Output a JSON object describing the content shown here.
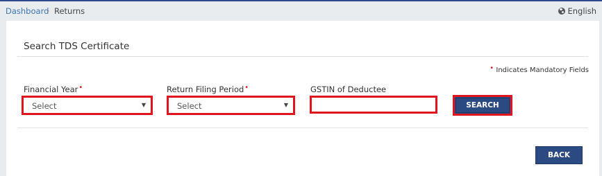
{
  "breadcrumb": {
    "dashboard": "Dashboard",
    "separator": "›",
    "current": "Returns"
  },
  "language": {
    "label": "English",
    "icon": "globe-icon"
  },
  "page": {
    "title": "Search TDS Certificate",
    "mandatory_marker": "•",
    "mandatory_note": "Indicates Mandatory Fields"
  },
  "form": {
    "financial_year": {
      "label": "Financial Year",
      "required_marker": "•",
      "value": "Select"
    },
    "return_filing_period": {
      "label": "Return Filing Period",
      "required_marker": "•",
      "value": "Select"
    },
    "gstin": {
      "label": "GSTIN of Deductee",
      "value": ""
    },
    "search_label": "SEARCH",
    "back_label": "BACK"
  },
  "colors": {
    "primary": "#2c4a82",
    "highlight": "#e0141e",
    "link": "#3a75b7"
  }
}
